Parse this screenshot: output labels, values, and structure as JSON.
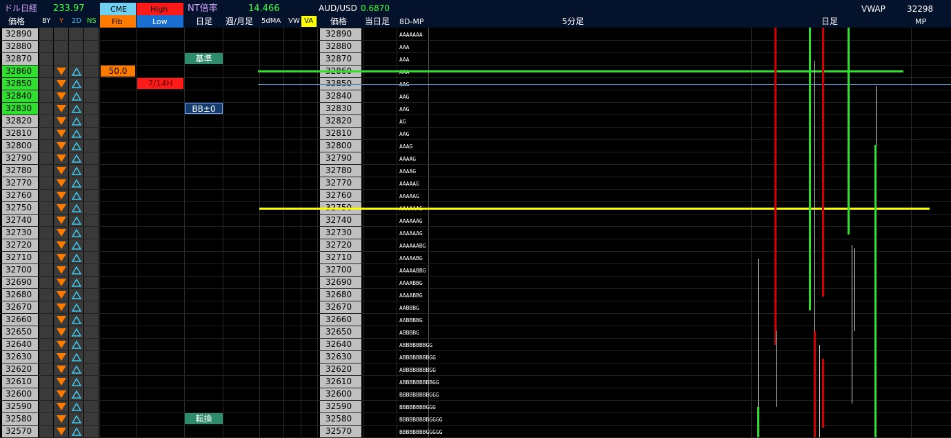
{
  "header": {
    "row1": {
      "title_dollar_nikkei": "ドル日経",
      "dollar_nikkei_value": "233.97",
      "cme_label": "CME",
      "high_label": "High",
      "nt_ratio_label": "NT倍率",
      "nt_ratio_value": "14.466",
      "audusd_label": "AUD/USD",
      "audusd_value": "0.6870",
      "vwap_label": "VWAP",
      "vwap_value": "32298"
    },
    "row2": {
      "price_label": "価格",
      "by_label": "BY",
      "y_label": "Y",
      "d2_label": "2D",
      "ns_label": "NS",
      "fib_label": "Fib",
      "low_label": "Low",
      "daily_label": "日足",
      "weekly_monthly_label": "週/月足",
      "ma5d_label": "5dMA",
      "vw_label": "VW",
      "va_label": "VA",
      "price_label_2": "価格",
      "today_label": "当日足",
      "mp8d_label": "8D-MP",
      "min5_label": "5分足",
      "daily_label_2": "日足",
      "mp_label": "MP"
    }
  },
  "prices": [
    "32890",
    "32880",
    "32870",
    "32860",
    "32850",
    "32840",
    "32830",
    "32820",
    "32810",
    "32800",
    "32790",
    "32780",
    "32770",
    "32760",
    "32750",
    "32740",
    "32730",
    "32720",
    "32710",
    "32700",
    "32690",
    "32680",
    "32670",
    "32660",
    "32650",
    "32640",
    "32630",
    "32620",
    "32610",
    "32600",
    "32590",
    "32580",
    "32570"
  ],
  "highlighted_prices": [
    "32860",
    "32850",
    "32840",
    "32830"
  ],
  "tpo_profile": [
    "AAAAAAA",
    "AAA",
    "AAA",
    "AAA",
    "AAG",
    "AAG",
    "AAG",
    "AG",
    "AAG",
    "AAAG",
    "AAAAG",
    "AAAAG",
    "AAAAAG",
    "AAAAAG",
    "AAAAAAG",
    "AAAAAAG",
    "AAAAAAG",
    "AAAAAABG",
    "AAAAABG",
    "AAAAABBG",
    "AAAABBG",
    "AAAABBG",
    "AABBBG",
    "AABBBBG",
    "ABBBBG",
    "ABBBBBBBGG",
    "ABBBBBBBBGG",
    "ABBBBBBBBGG",
    "ABBBBBBBBBGG",
    "BBBBBBBBBGGG",
    "BBBBBBBBGGG",
    "BBBBBBBBBGGGG",
    "BBBBBBBBGGGGG"
  ],
  "labels": {
    "fib_value": "50.0",
    "low_value": "7/14H",
    "kijun": "基準",
    "bb": "BB±0",
    "tenkan": "転換"
  },
  "colors": {
    "header_bg": "#05122b",
    "highlight_green": "#2fe02f",
    "orange": "#ff7b00",
    "red": "#ff0000",
    "yellow": "#ffff00",
    "cyan": "#3ecbf0",
    "teal_label": "#2e8b6b"
  }
}
